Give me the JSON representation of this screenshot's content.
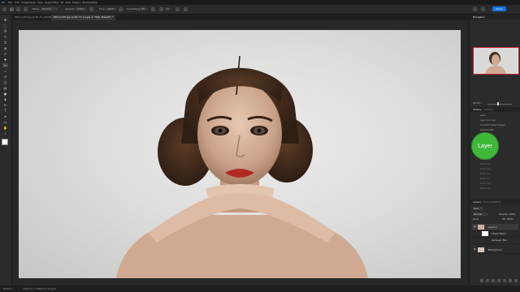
{
  "app": {
    "name": "Photoshop"
  },
  "menu": [
    "Ps",
    "File",
    "Edit",
    "Image",
    "Layer",
    "Type",
    "Select",
    "Filter",
    "3D",
    "View",
    "Plugins",
    "Window",
    "Help"
  ],
  "options": {
    "mode_label": "Mode:",
    "mode_value": "Normal",
    "opacity_label": "Opacity:",
    "opacity_value": "100%",
    "flow_label": "Flow:",
    "flow_value": "100%",
    "smoothing_label": "Smoothing:",
    "smoothing_value": "0%",
    "angle_value": "0°"
  },
  "tabs": [
    {
      "label": "REG-0145.jpg @ 66.7% (RGB/8)",
      "active": false
    },
    {
      "label": "REG-0145.jpg @ 66.7% (Layer 1, Filter Mask/8) *",
      "active": true
    }
  ],
  "status": {
    "zoom": "66.67%",
    "doc_info": "3000 px x 1688 px (72 ppi)"
  },
  "share_label": "Share",
  "panels": {
    "navigator_title": "Navigator",
    "zoom_value": "66.67%",
    "history_tabs": [
      "History",
      "Actions"
    ],
    "history_items": [
      "Open",
      "Layer Via Copy",
      "Convert to Smart Object",
      "Gaussian Blur",
      "Brush Tool",
      "Brush Tool",
      "Brush Tool",
      "Brush Tool",
      "Brush Tool",
      "Brush Tool",
      "Brush Tool",
      "Brush Tool",
      "Brush Tool",
      "Brush Tool"
    ],
    "layers_tabs": [
      "Layers",
      "Channels",
      "Paths"
    ],
    "kind_label": "Kind",
    "blend_mode": "Normal",
    "opacity_label": "Opacity: 100%",
    "lock_label": "Lock:",
    "fill_label": "Fill: 100%",
    "layers": [
      "Layer 1",
      "Smart Filters",
      "Gaussian Blur",
      "Background"
    ]
  },
  "callout": {
    "label": "Layer"
  },
  "colors": {
    "accent": "#3fb83a",
    "panel": "#2b2b2b",
    "menubar": "#1a1a1a",
    "share": "#1473e6"
  }
}
